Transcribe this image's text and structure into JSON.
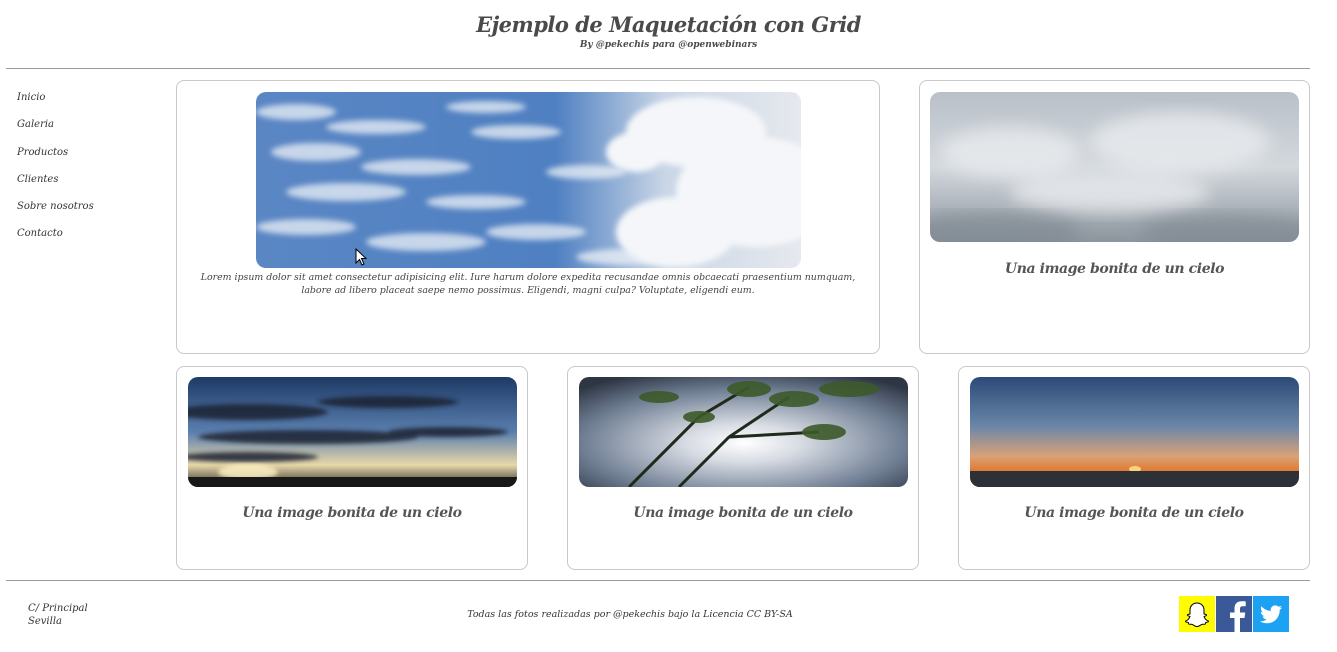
{
  "header": {
    "title": "Ejemplo de Maquetación con Grid",
    "subtitle": "By @pekechis para @openwebinars"
  },
  "sidebar": {
    "items": [
      {
        "label": "Inicio"
      },
      {
        "label": "Galeria"
      },
      {
        "label": "Productos"
      },
      {
        "label": "Clientes"
      },
      {
        "label": "Sobre nosotros"
      },
      {
        "label": "Contacto"
      }
    ]
  },
  "main": {
    "featured": {
      "text": "Lorem ipsum dolor sit amet consectetur adipisicing elit. Iure harum dolore expedita recusandae omnis obcaecati praesentium numquam, labore ad libero placeat saepe nemo possimus. Eligendi, magni culpa? Voluptate, eligendi eum."
    },
    "cards": [
      {
        "caption": "Una image bonita de un cielo"
      },
      {
        "caption": "Una image bonita de un cielo"
      },
      {
        "caption": "Una image bonita de un cielo"
      },
      {
        "caption": "Una image bonita de un cielo"
      }
    ]
  },
  "footer": {
    "address_line1": "C/ Principal",
    "address_line2": "Sevilla",
    "credits": "Todas las fotos realizadas por @pekechis bajo la Licencia CC BY-SA",
    "social": [
      {
        "icon": "snapchat-icon",
        "color": "#FFFC00"
      },
      {
        "icon": "facebook-icon",
        "color": "#3B5998"
      },
      {
        "icon": "twitter-icon",
        "color": "#1DA1F2"
      }
    ]
  }
}
